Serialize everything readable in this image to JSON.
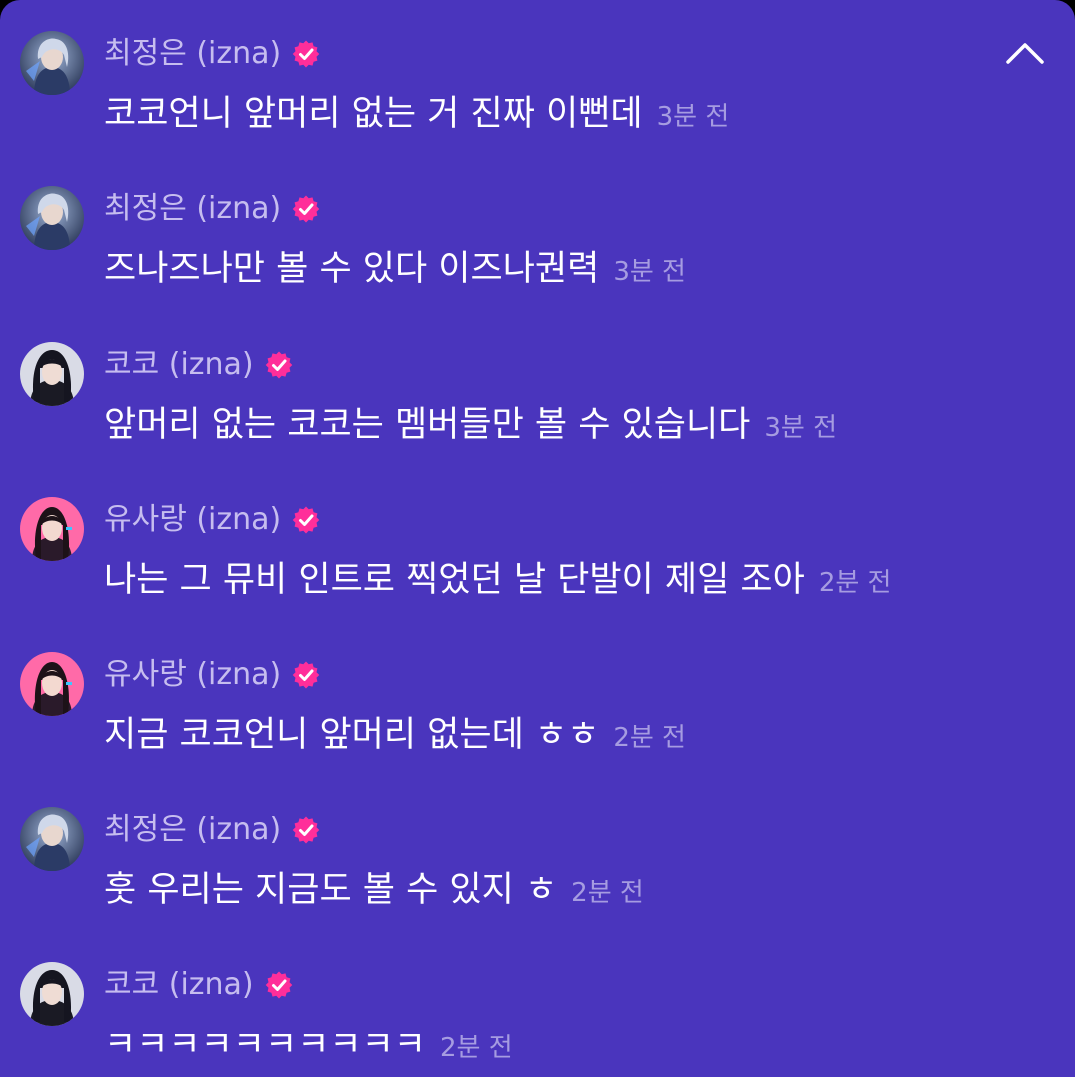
{
  "colors": {
    "background": "#4a35bd",
    "name_text": "#c6bdef",
    "message_text": "#ffffff",
    "timestamp_text": "#a69ce1",
    "verified_badge": "#ff2e9a"
  },
  "header": {
    "collapse_icon": "chevron-up-icon"
  },
  "messages": [
    {
      "author": "최정은 (izna)",
      "verified": true,
      "text": "코코언니 앞머리 없는 거 진짜 이뻔데",
      "time": "3분 전"
    },
    {
      "author": "최정은 (izna)",
      "verified": true,
      "text": "즈나즈나만 볼 수 있다 이즈나권력",
      "time": "3분 전"
    },
    {
      "author": "코코 (izna)",
      "verified": true,
      "text": "앞머리 없는 코코는 멤버들만 볼 수 있습니다",
      "time": "3분 전"
    },
    {
      "author": "유사랑 (izna)",
      "verified": true,
      "text": "나는 그 뮤비 인트로 찍었던 날 단발이 제일 조아",
      "time": "2분 전"
    },
    {
      "author": "유사랑 (izna)",
      "verified": true,
      "text": "지금 코코언니 앞머리 없는데 ㅎㅎ",
      "time": "2분 전"
    },
    {
      "author": "최정은 (izna)",
      "verified": true,
      "text": "훗 우리는 지금도 볼 수 있지 ㅎ",
      "time": "2분 전"
    },
    {
      "author": "코코 (izna)",
      "verified": true,
      "text": "ㅋㅋㅋㅋㅋㅋㅋㅋㅋㅋ",
      "time": "2분 전"
    }
  ]
}
